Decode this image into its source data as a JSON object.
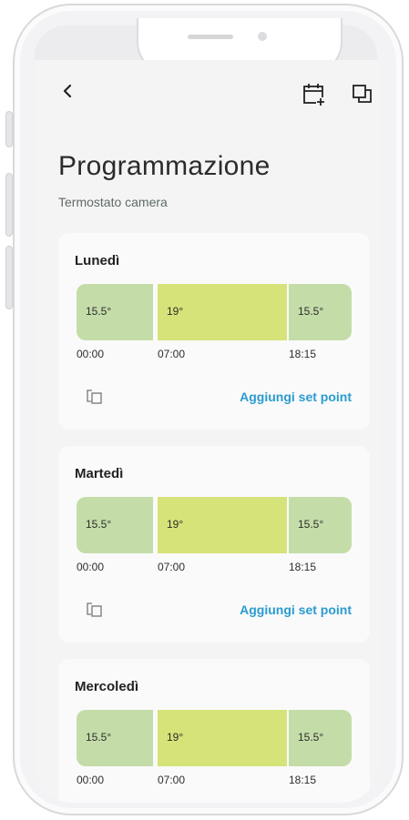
{
  "header": {
    "back_icon": "chevron-left-icon",
    "calendar_add_icon": "calendar-plus-icon",
    "copy_icon": "copy-icon"
  },
  "page": {
    "title": "Programmazione",
    "subtitle": "Termostato camera"
  },
  "colors": {
    "setpoint_low": "#c4dda8",
    "setpoint_high": "#d6e378",
    "link": "#2a9bd0"
  },
  "days": [
    {
      "name": "Lunedì",
      "segments": [
        "15.5°",
        "19°",
        "15.5°"
      ],
      "times": [
        "00:00",
        "07:00",
        "18:15"
      ],
      "add_label": "Aggiungi set point"
    },
    {
      "name": "Martedì",
      "segments": [
        "15.5°",
        "19°",
        "15.5°"
      ],
      "times": [
        "00:00",
        "07:00",
        "18:15"
      ],
      "add_label": "Aggiungi set point"
    },
    {
      "name": "Mercoledì",
      "segments": [
        "15.5°",
        "19°",
        "15.5°"
      ],
      "times": [
        "00:00",
        "07:00",
        "18:15"
      ]
    }
  ]
}
